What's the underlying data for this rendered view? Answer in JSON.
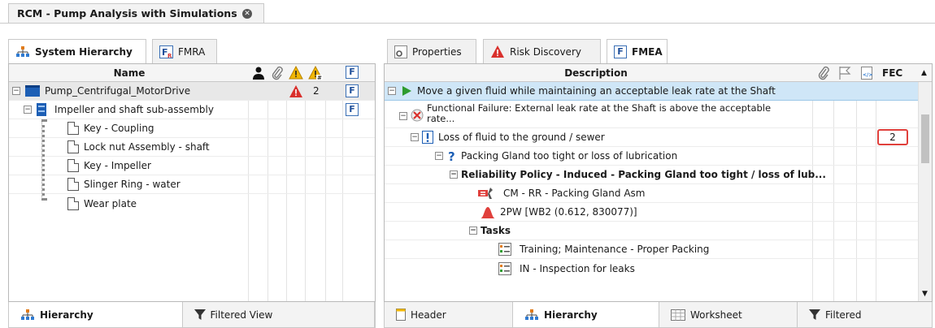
{
  "document_tab": {
    "title": "RCM - Pump Analysis with Simulations"
  },
  "left_panel": {
    "tabs": [
      {
        "label": "System Hierarchy",
        "active": true
      },
      {
        "label": "FMRA",
        "active": false
      }
    ],
    "header": {
      "name": "Name",
      "f_label": "F"
    },
    "rows": [
      {
        "label": "Pump_Centrifugal_MotorDrive",
        "warning_count": "2",
        "f_label": "F"
      },
      {
        "label": "Impeller and shaft sub-assembly",
        "f_label": "F"
      },
      {
        "label": "Key - Coupling"
      },
      {
        "label": "Lock nut Assembly - shaft"
      },
      {
        "label": "Key - Impeller"
      },
      {
        "label": "Slinger Ring - water"
      },
      {
        "label": "Wear plate"
      }
    ],
    "bottom_tabs": [
      {
        "label": "Hierarchy",
        "active": true
      },
      {
        "label": "Filtered View",
        "active": false
      }
    ]
  },
  "right_panel": {
    "tabs": [
      {
        "label": "Properties",
        "active": false
      },
      {
        "label": "Risk Discovery",
        "active": false
      },
      {
        "label": "FMEA",
        "f_label": "F",
        "active": true
      }
    ],
    "header": {
      "description": "Description",
      "fec": "FEC"
    },
    "rows": [
      {
        "label": "Move a given fluid while maintaining an acceptable leak rate at the Shaft"
      },
      {
        "label": "Functional Failure: External leak rate at the Shaft is above the acceptable",
        "label2": "rate..."
      },
      {
        "label": "Loss of fluid to the ground / sewer",
        "fec": "2"
      },
      {
        "label": "Packing Gland too tight or loss of lubrication"
      },
      {
        "label": "Reliability Policy - Induced - Packing Gland too tight / loss of lub..."
      },
      {
        "label": "CM - RR - Packing Gland Asm"
      },
      {
        "label": "2PW [WB2 (0.612, 830077)]"
      },
      {
        "label": "Tasks"
      },
      {
        "label": "Training; Maintenance - Proper Packing"
      },
      {
        "label": "IN - Inspection for leaks"
      }
    ],
    "bottom_tabs": [
      {
        "label": "Header",
        "active": false
      },
      {
        "label": "Hierarchy",
        "active": true
      },
      {
        "label": "Worksheet",
        "active": false
      },
      {
        "label": "Filtered",
        "active": false
      }
    ]
  },
  "colors": {
    "accent_blue": "#1f4f99",
    "warning_red": "#d9302c",
    "warning_yellow": "#f2b705",
    "play_green": "#2e9b2e",
    "selected_blue": "#cfe6f7"
  }
}
